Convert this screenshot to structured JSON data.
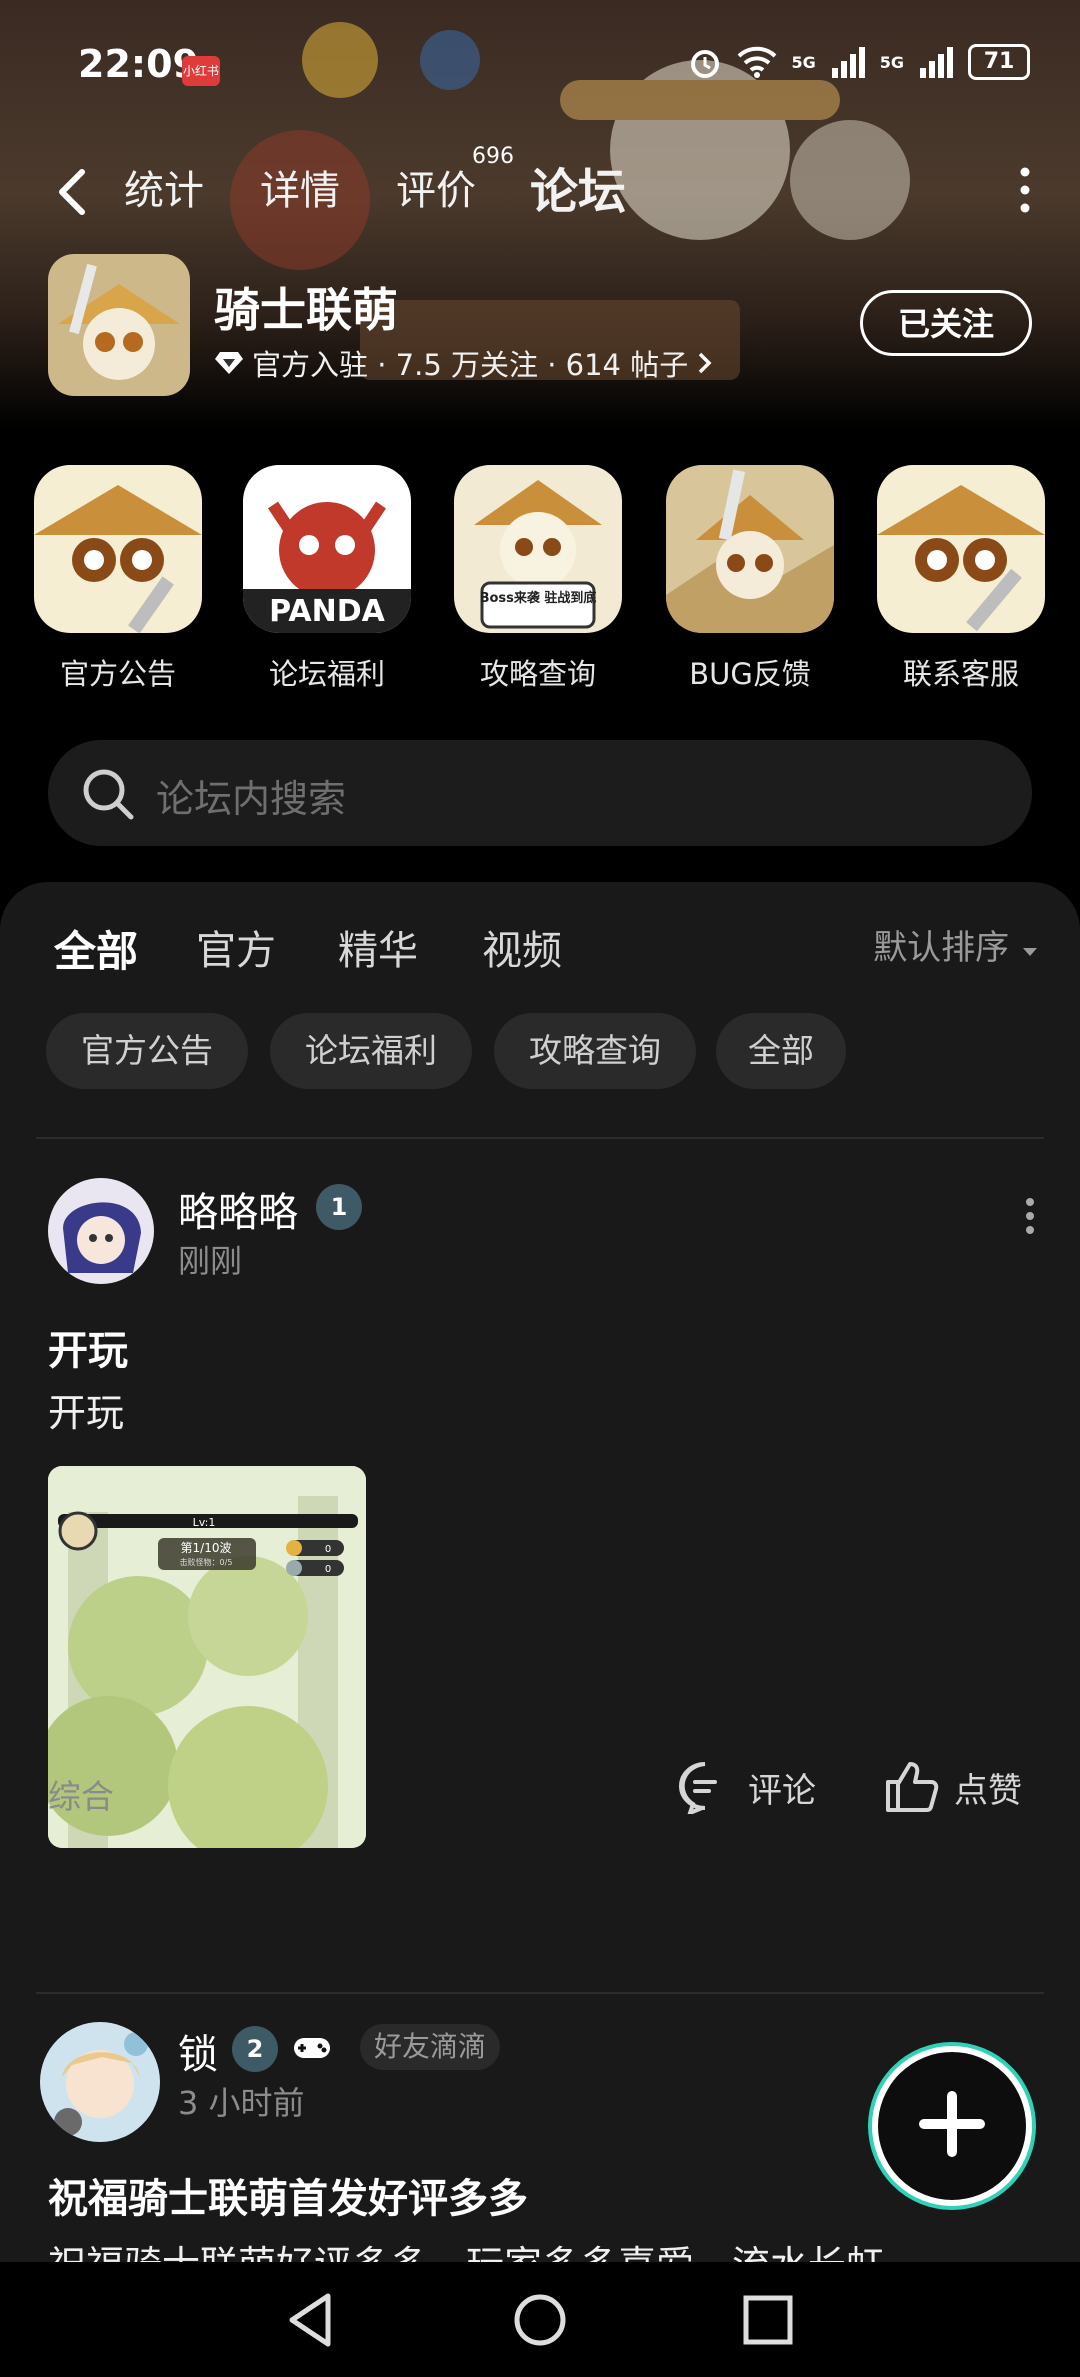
{
  "status": {
    "time": "22:09",
    "badge": "小红书",
    "battery": "71",
    "net1": "5G",
    "net2": "5G"
  },
  "nav": {
    "tabs": [
      {
        "label": "统计"
      },
      {
        "label": "详情"
      },
      {
        "label": "评价"
      },
      {
        "label": "论坛"
      }
    ],
    "review_count": "696",
    "active_tab": "论坛"
  },
  "game": {
    "name": "骑士联萌",
    "meta": "官方入驻 · 7.5 万关注 · 614 帖子",
    "follow_label": "已关注"
  },
  "shortcuts": [
    {
      "label": "官方公告",
      "icon": "panda-knight-icon"
    },
    {
      "label": "论坛福利",
      "icon": "panda-dragon-icon",
      "text": "PANDA"
    },
    {
      "label": "攻略查询",
      "icon": "boss-guide-icon",
      "text": "Boss来袭 驻战到底"
    },
    {
      "label": "BUG反馈",
      "icon": "panda-knight-desert-icon"
    },
    {
      "label": "联系客服",
      "icon": "panda-knight-sword-icon"
    }
  ],
  "search": {
    "placeholder": "论坛内搜索"
  },
  "filter": {
    "tabs": [
      {
        "label": "全部"
      },
      {
        "label": "官方"
      },
      {
        "label": "精华"
      },
      {
        "label": "视频"
      }
    ],
    "sort": "默认排序",
    "chips": [
      {
        "label": "官方公告"
      },
      {
        "label": "论坛福利"
      },
      {
        "label": "攻略查询"
      },
      {
        "label": "全部"
      }
    ]
  },
  "posts": [
    {
      "author": "略略略",
      "level": "1",
      "time": "刚刚",
      "title": "开玩",
      "body": "开玩",
      "thumb": {
        "level_label": "Lv:1",
        "wave": "第1/10波",
        "kills": "击败怪物：0/5",
        "coins": "0",
        "gems": "0"
      },
      "category": "综合",
      "comment_label": "评论",
      "like_label": "点赞"
    },
    {
      "author": "锁",
      "level": "2",
      "tag": "好友滴滴",
      "time": "3 小时前",
      "title": "祝福骑士联萌首发好评多多",
      "body": "祝福骑士联萌好评多多，玩家多多喜爱，流水长虹"
    }
  ],
  "colors": {
    "accent": "#2ed3b7",
    "panel": "#191919",
    "chip": "#2a2a2a"
  }
}
